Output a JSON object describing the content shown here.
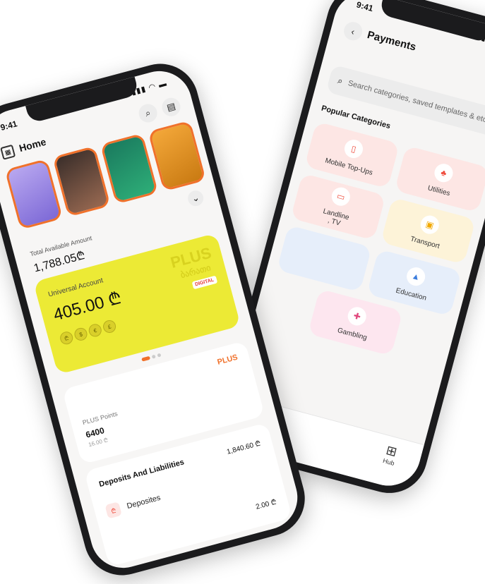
{
  "payments_screen": {
    "status_time": "9:41",
    "title": "Payments",
    "back_icon": "chevron-left-icon",
    "support_icon": "whatsapp-icon",
    "search": {
      "placeholder": "Search categories, saved templates & etc"
    },
    "section_title": "Popular Categories",
    "categories": [
      {
        "label": "Mobile Top-Ups",
        "icon": "phone-icon",
        "color": "#fde6e4"
      },
      {
        "label": "Utilities",
        "icon": "utilities-icon",
        "color": "#fde6e4"
      },
      {
        "label": "Landline\n, TV",
        "icon": "tv-icon",
        "color": "#fde6e4"
      },
      {
        "label": "Transport",
        "icon": "bus-icon",
        "color": "#fdf3d8"
      },
      {
        "label": "",
        "icon": "",
        "color": "#e6eefa"
      },
      {
        "label": "Education",
        "icon": "graduation-icon",
        "color": "#e6eefa"
      },
      {
        "label": "Gambling",
        "icon": "gamepad-icon",
        "color": "#fde6ef"
      }
    ],
    "hub_label": "Hub"
  },
  "home_screen": {
    "status_time": "9:41",
    "title": "Home",
    "total_label": "Total Available Amount",
    "total_value": "1,788.05₾",
    "account": {
      "name": "Universal Account",
      "balance": "405.00 ₾",
      "brand": "PLUS",
      "brand_sub": "ბარათი",
      "badge": "DIGITAL",
      "currencies": [
        "₾",
        "$",
        "€",
        "£"
      ]
    },
    "plus_brand": "PLUS",
    "points": {
      "label": "PLUS Points",
      "value": "6400",
      "sub": "16.00 ₾"
    },
    "deposits": {
      "title": "Deposits And Liabilities",
      "total": "1,840.60 ₾",
      "item_label": "Deposites",
      "item_value": "2.00 ₾"
    }
  },
  "colors": {
    "accent": "#f0712b",
    "card_yellow": "#ecea35"
  }
}
